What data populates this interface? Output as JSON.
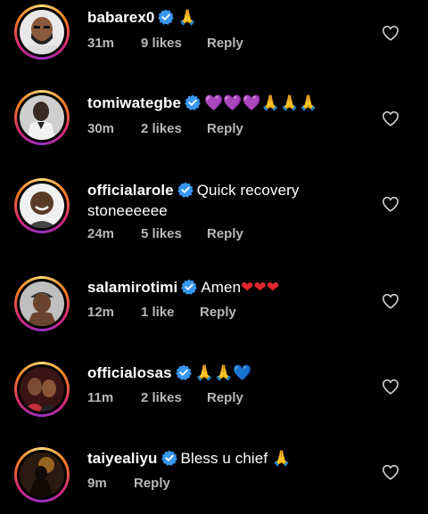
{
  "comments": [
    {
      "username": "babarex0",
      "text_segments": [
        {
          "text": "🙏",
          "style": "hands-light"
        }
      ],
      "time": "31m",
      "likes": "9 likes",
      "reply": "Reply",
      "avatar_icon": "man-with-beard-avatar"
    },
    {
      "username": "tomiwategbe",
      "text_segments": [
        {
          "text": "💜💜💜",
          "style": "purple"
        },
        {
          "text": "🙏🙏🙏",
          "style": "hands"
        }
      ],
      "time": "30m",
      "likes": "2 likes",
      "reply": "Reply",
      "avatar_icon": "man-in-white-shirt-avatar"
    },
    {
      "username": "officialarole",
      "text_segments": [
        {
          "text": "Quick recovery stoneeeeee",
          "style": "plain"
        }
      ],
      "time": "24m",
      "likes": "5 likes",
      "reply": "Reply",
      "avatar_icon": "smiling-man-avatar"
    },
    {
      "username": "salamirotimi",
      "text_segments": [
        {
          "text": "Amen",
          "style": "plain"
        },
        {
          "text": "❤❤❤",
          "style": "red"
        }
      ],
      "time": "12m",
      "likes": "1 like",
      "reply": "Reply",
      "avatar_icon": "man-in-cap-avatar"
    },
    {
      "username": "officialosas",
      "text_segments": [
        {
          "text": "🙏🙏",
          "style": "hands"
        },
        {
          "text": "💙",
          "style": "blue"
        }
      ],
      "time": "11m",
      "likes": "2 likes",
      "reply": "Reply",
      "avatar_icon": "two-women-avatar"
    },
    {
      "username": "taiyealiyu",
      "text_segments": [
        {
          "text": "Bless u chief ",
          "style": "plain"
        },
        {
          "text": "🙏",
          "style": "hands"
        }
      ],
      "time": "9m",
      "likes": "",
      "reply": "Reply",
      "avatar_icon": "man-silhouette-avatar"
    }
  ],
  "colors": {
    "background": "#000000",
    "text": "#ffffff",
    "meta": "#b8b8b8",
    "verified": "#3897f0"
  },
  "icons": {
    "verified": "verified-badge-icon",
    "like": "heart-outline-icon"
  }
}
